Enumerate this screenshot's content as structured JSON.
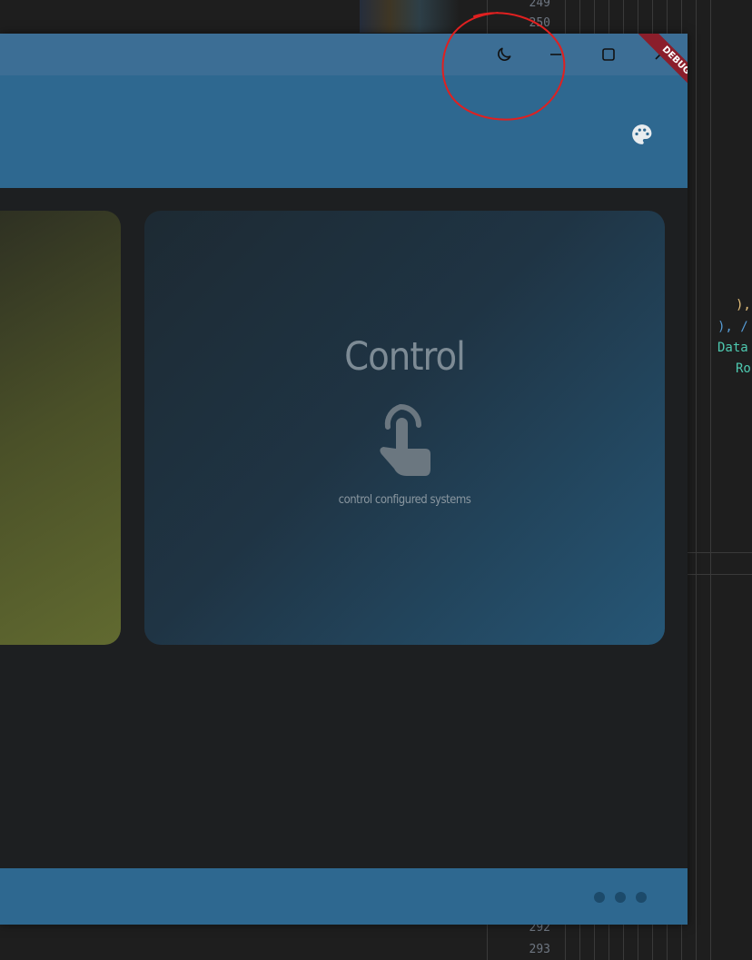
{
  "editor": {
    "line_numbers_top": [
      "249",
      "250"
    ],
    "line_numbers_bottom": [
      "292",
      "293"
    ],
    "code_lines": [
      "),",
      "), /",
      "Data",
      "Ro"
    ]
  },
  "window": {
    "theme_toggle_icon": "moon-icon",
    "minimize_icon": "minimize-icon",
    "maximize_icon": "maximize-icon",
    "close_icon": "close-icon",
    "debug_label": "DEBUG"
  },
  "appbar": {
    "palette_icon": "palette-icon"
  },
  "cards": {
    "control": {
      "title": "Control",
      "icon": "touch-icon",
      "description": "control configured systems"
    }
  },
  "bottom_bar": {
    "more_icon": "more-horiz-icon"
  },
  "colors": {
    "primary": "#2e6890",
    "titlebar": "#3c6e95",
    "background": "#1d1f21",
    "annotation": "#e02020"
  }
}
